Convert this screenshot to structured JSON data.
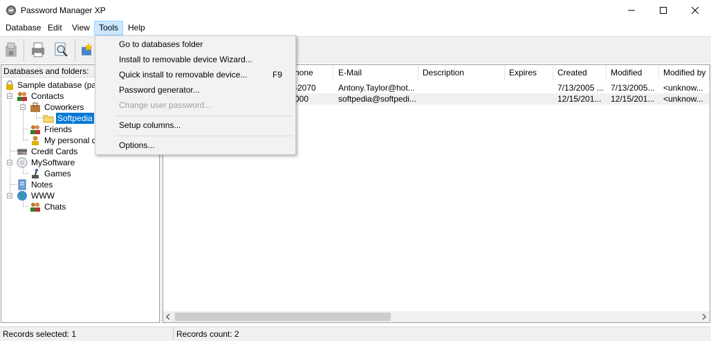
{
  "window": {
    "title": "Password Manager XP"
  },
  "menubar": [
    {
      "label": "Database"
    },
    {
      "label": "Edit"
    },
    {
      "label": "View"
    },
    {
      "label": "Tools"
    },
    {
      "label": "Help"
    }
  ],
  "tools_menu": {
    "items": [
      {
        "label": "Go to databases folder",
        "shortcut": "",
        "disabled": false
      },
      {
        "label": "Install to removable device Wizard...",
        "shortcut": "",
        "disabled": false
      },
      {
        "label": "Quick install to removable device...",
        "shortcut": "F9",
        "disabled": false
      },
      {
        "label": "Password generator...",
        "shortcut": "",
        "disabled": false
      },
      {
        "label": "Change user password...",
        "shortcut": "",
        "disabled": true
      },
      {
        "label": "Setup columns...",
        "shortcut": "",
        "disabled": false
      },
      {
        "label": "Options...",
        "shortcut": "",
        "disabled": false
      }
    ]
  },
  "left_pane": {
    "header": "Databases and folders:",
    "tree": [
      {
        "label": "Sample database (pass",
        "icon": "lock-icon"
      },
      {
        "label": "Contacts",
        "icon": "people-icon"
      },
      {
        "label": "Coworkers",
        "icon": "briefcase-icon"
      },
      {
        "label": "Softpedia",
        "icon": "folder-icon"
      },
      {
        "label": "Friends",
        "icon": "people-icon"
      },
      {
        "label": "My personal da",
        "icon": "person-icon"
      },
      {
        "label": "Credit Cards",
        "icon": "credit-card-icon"
      },
      {
        "label": "MySoftware",
        "icon": "cd-icon"
      },
      {
        "label": "Games",
        "icon": "joystick-icon"
      },
      {
        "label": "Notes",
        "icon": "notes-icon"
      },
      {
        "label": "WWW",
        "icon": "globe-icon"
      },
      {
        "label": "Chats",
        "icon": "people-icon"
      }
    ]
  },
  "table": {
    "columns": [
      "hone",
      "E-Mail",
      "Description",
      "Expires",
      "Created",
      "Modified",
      "Modified by"
    ],
    "rows": [
      [
        "-2070",
        "Antony.Taylor@hot...",
        "",
        "",
        "7/13/2005 ...",
        "7/13/2005...",
        "<unknow..."
      ],
      [
        "000",
        "softpedia@softpedi...",
        "",
        "",
        "12/15/201...",
        "12/15/201...",
        "<unknow..."
      ]
    ]
  },
  "statusbar": {
    "records_selected": "Records selected: 1",
    "records_count": "Records count: 2"
  },
  "colors": {
    "selection": "#0078d7",
    "menu_highlight": "#cce8ff"
  }
}
